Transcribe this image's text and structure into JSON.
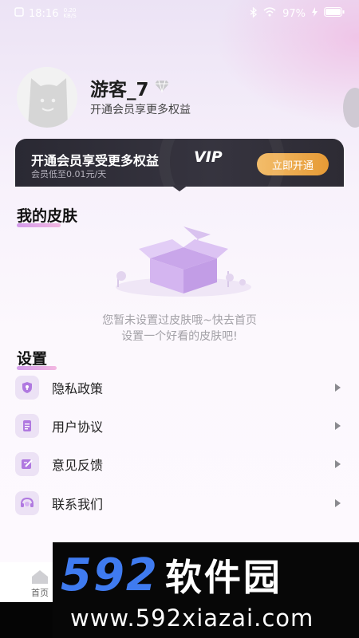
{
  "status_bar": {
    "time": "18:16",
    "net_speed_top": "0.20",
    "net_speed_bottom": "KB/S",
    "battery": "97%"
  },
  "profile": {
    "username": "游客_7",
    "subtitle": "开通会员享更多权益"
  },
  "vip_banner": {
    "title": "开通会员享受更多权益",
    "vip_word": "VIP",
    "subtitle": "会员低至0.01元/天",
    "button_label": "立即开通"
  },
  "skins": {
    "title": "我的皮肤",
    "empty_line1": "您暂未设置过皮肤哦~快去首页",
    "empty_line2": "设置一个好看的皮肤吧!"
  },
  "settings": {
    "title": "设置",
    "items": [
      {
        "label": "隐私政策",
        "icon": "privacy-icon"
      },
      {
        "label": "用户协议",
        "icon": "document-icon"
      },
      {
        "label": "意见反馈",
        "icon": "feedback-icon"
      },
      {
        "label": "联系我们",
        "icon": "headset-icon"
      }
    ]
  },
  "bottom_nav": {
    "home_label": "首页"
  },
  "watermark": {
    "number": "592",
    "chinese": "软件园",
    "url": "www.592xiazai.com"
  },
  "colors": {
    "accent": "#e69a35",
    "banner_bg": "#2a2933",
    "underline": "#c77de6",
    "watermark_blue": "#3f7bf0"
  }
}
